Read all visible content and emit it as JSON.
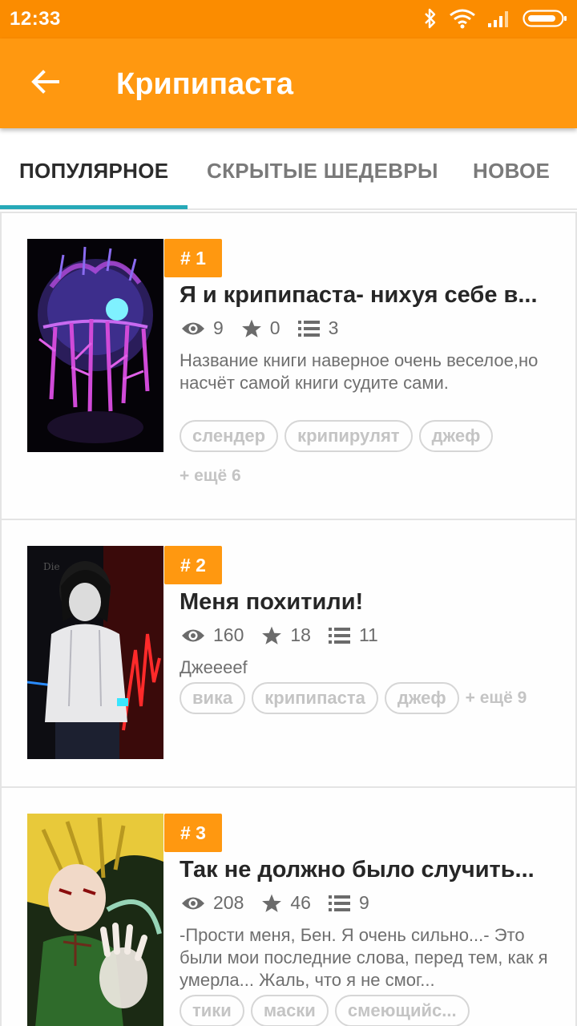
{
  "status_bar": {
    "time": "12:33",
    "icons": [
      "bluetooth-icon",
      "wifi-icon",
      "signal-icon",
      "battery-icon"
    ]
  },
  "app_bar": {
    "title": "Крипипаста",
    "back_icon": "arrow-back-icon"
  },
  "tabs": [
    {
      "label": "ПОПУЛЯРНОЕ",
      "active": true
    },
    {
      "label": "СКРЫТЫЕ ШЕДЕВРЫ",
      "active": false
    },
    {
      "label": "НОВОЕ",
      "active": false
    }
  ],
  "colors": {
    "status_bar": "#fb8c00",
    "app_bar": "#ff9810",
    "tab_indicator": "#26a9b8",
    "rank_badge": "#ff9810"
  },
  "books": [
    {
      "rank": "# 1",
      "title": "Я и крипипаста- нихуя себе в...",
      "views": "9",
      "stars": "0",
      "chapters": "3",
      "description": "Название книги наверное очень веселое,но насчёт самой книги судите сами.",
      "tags": [
        "слендер",
        "крипирулят",
        "джеф"
      ],
      "more": "+ ещё 6"
    },
    {
      "rank": "# 2",
      "title": "Меня похитили!",
      "views": "160",
      "stars": "18",
      "chapters": "11",
      "description": "Джеееef",
      "tags": [
        "вика",
        "крипипаста",
        "джеф"
      ],
      "more": "+ ещё 9"
    },
    {
      "rank": "# 3",
      "title": "Так не должно было случить...",
      "views": "208",
      "stars": "46",
      "chapters": "9",
      "description": "-Прости меня, Бен. Я очень сильно...- Это были мои последние слова, перед тем, как я умерла... Жаль, что я не смог...",
      "tags": [
        "тики",
        "маски",
        "смеющийс..."
      ],
      "more": ""
    }
  ]
}
